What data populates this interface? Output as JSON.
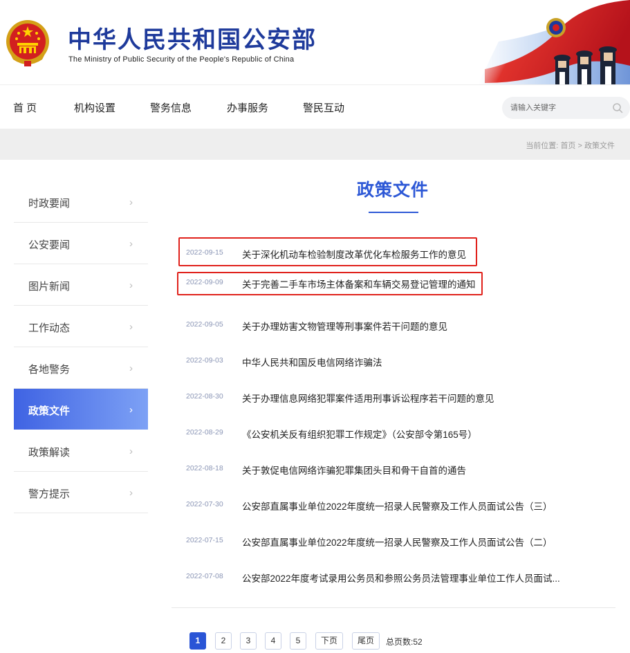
{
  "header": {
    "title": "中华人民共和国公安部",
    "subtitle": "The Ministry of Public Security of the People's Republic of China",
    "emblem_icon": "national-emblem-icon",
    "banner_icon": "flag-police-banner",
    "brand_color": "#1e3a9b"
  },
  "nav": {
    "items": [
      {
        "label": "首 页"
      },
      {
        "label": "机构设置"
      },
      {
        "label": "警务信息"
      },
      {
        "label": "办事服务"
      },
      {
        "label": "警民互动"
      }
    ],
    "search": {
      "placeholder": "请输入关键字",
      "icon": "search-icon"
    }
  },
  "breadcrumb": {
    "prefix": "当前位置:",
    "home": "首页",
    "separator": ">",
    "current": "政策文件"
  },
  "sidebar": {
    "items": [
      {
        "label": "时政要闻",
        "active": false
      },
      {
        "label": "公安要闻",
        "active": false
      },
      {
        "label": "图片新闻",
        "active": false
      },
      {
        "label": "工作动态",
        "active": false
      },
      {
        "label": "各地警务",
        "active": false
      },
      {
        "label": "政策文件",
        "active": true
      },
      {
        "label": "政策解读",
        "active": false
      },
      {
        "label": "警方提示",
        "active": false
      }
    ],
    "chevron": "›",
    "active_gradient": [
      "#3f63e3",
      "#7da1f5"
    ]
  },
  "main": {
    "title": "政策文件",
    "accent_color": "#2d58d6",
    "highlight_color": "#e0211b",
    "documents": [
      {
        "date": "2022-09-15",
        "title": "关于深化机动车检验制度改革优化车检服务工作的意见",
        "highlighted": true
      },
      {
        "date": "2022-09-09",
        "title": "关于完善二手车市场主体备案和车辆交易登记管理的通知",
        "highlighted": true
      },
      {
        "date": "2022-09-05",
        "title": "关于办理妨害文物管理等刑事案件若干问题的意见",
        "highlighted": false
      },
      {
        "date": "2022-09-03",
        "title": "中华人民共和国反电信网络诈骗法",
        "highlighted": false
      },
      {
        "date": "2022-08-30",
        "title": "关于办理信息网络犯罪案件适用刑事诉讼程序若干问题的意见",
        "highlighted": false
      },
      {
        "date": "2022-08-29",
        "title": "《公安机关反有组织犯罪工作规定》（公安部令第165号）",
        "highlighted": false
      },
      {
        "date": "2022-08-18",
        "title": "关于敦促电信网络诈骗犯罪集团头目和骨干自首的通告",
        "highlighted": false
      },
      {
        "date": "2022-07-30",
        "title": "公安部直属事业单位2022年度统一招录人民警察及工作人员面试公告（三）",
        "highlighted": false
      },
      {
        "date": "2022-07-15",
        "title": "公安部直属事业单位2022年度统一招录人民警察及工作人员面试公告（二）",
        "highlighted": false
      },
      {
        "date": "2022-07-08",
        "title": "公安部2022年度考试录用公务员和参照公务员法管理事业单位工作人员面试...",
        "highlighted": false
      }
    ]
  },
  "pagination": {
    "pages": [
      "1",
      "2",
      "3",
      "4",
      "5"
    ],
    "current": "1",
    "next": "下页",
    "last": "尾页",
    "total": "总页数:52"
  }
}
